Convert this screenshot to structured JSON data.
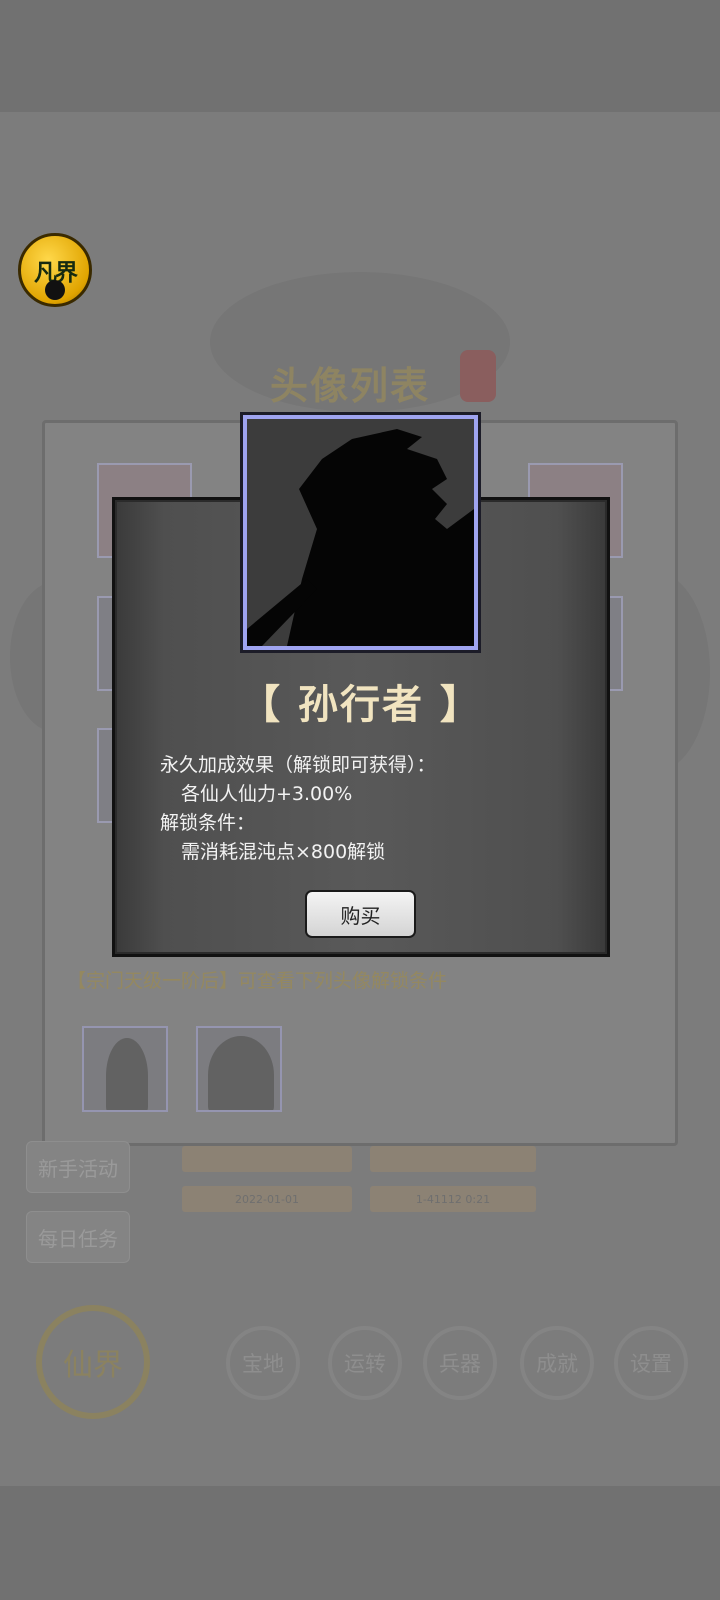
{
  "background": {
    "realm_badge_label": "凡界",
    "list_title": "头像列表",
    "unlock_notice": "【宗门天级一阶后】可查看下列头像解锁条件",
    "side_buttons": [
      "新手活动",
      "每日任务"
    ],
    "stub_labels": [
      "2022-01-01",
      "1-41112 0:21"
    ],
    "nav_main_label": "仙界",
    "nav_buttons": [
      "宝地",
      "运转",
      "兵器",
      "成就",
      "设置"
    ]
  },
  "dialog": {
    "character_name": "【 孙行者 】",
    "bonus_heading": "永久加成效果（解锁即可获得）：",
    "bonus_value": "各仙人仙力+3.00%",
    "unlock_heading": "解锁条件：",
    "unlock_value": "需消耗混沌点×800解锁",
    "buy_label": "购买"
  },
  "colors": {
    "overlay": "#7c7c7c",
    "modal_border": "#111111",
    "portrait_border": "#9fa4f0",
    "name_color": "#f1e4c0",
    "text_color": "#f2f2f2"
  }
}
